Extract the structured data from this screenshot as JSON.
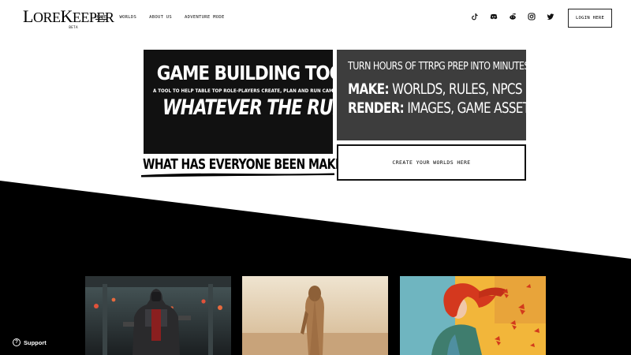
{
  "logo": {
    "initial_l": "L",
    "rest_l": "ORE",
    "initial_k": "K",
    "rest_k": "EEPER",
    "sub": "BETA"
  },
  "nav": {
    "items": [
      {
        "label": "HOME",
        "active": true
      },
      {
        "label": "WORLDS"
      },
      {
        "label": "ABOUT US"
      },
      {
        "label": "ADVENTURE MODE"
      }
    ]
  },
  "socials": [
    "tiktok-icon",
    "discord-icon",
    "reddit-icon",
    "instagram-icon",
    "twitter-icon"
  ],
  "header": {
    "login_label": "LOGIN HERE"
  },
  "hero": {
    "title": "GAME BUILDING TOOLS",
    "subtitle": "A TOOL TO HELP TABLE TOP ROLE-PLAYERS CREATE, PLAN AND RUN CAMPAIGNS.",
    "tagline": "WHATEVER THE RULES.",
    "right_line1": "TURN HOURS OF TTRPG PREP INTO MINUTES",
    "make_label": "MAKE:",
    "make_items": "WORLDS, RULES, NPCS",
    "render_label": "RENDER:",
    "render_items": "IMAGES, GAME ASSETS",
    "making_link": "WHAT HAS EVERYONE BEEN MAKING?",
    "create_button": "CREATE YOUR WORLDS HERE"
  },
  "gallery": [
    "armored-knight-image",
    "desert-wanderer-image",
    "red-haired-woman-butterflies-image"
  ],
  "support": {
    "label": "Support"
  },
  "colors": {
    "black": "#000000",
    "panel_dark": "#111111",
    "panel_grey": "#3d3d3d",
    "white": "#ffffff"
  }
}
